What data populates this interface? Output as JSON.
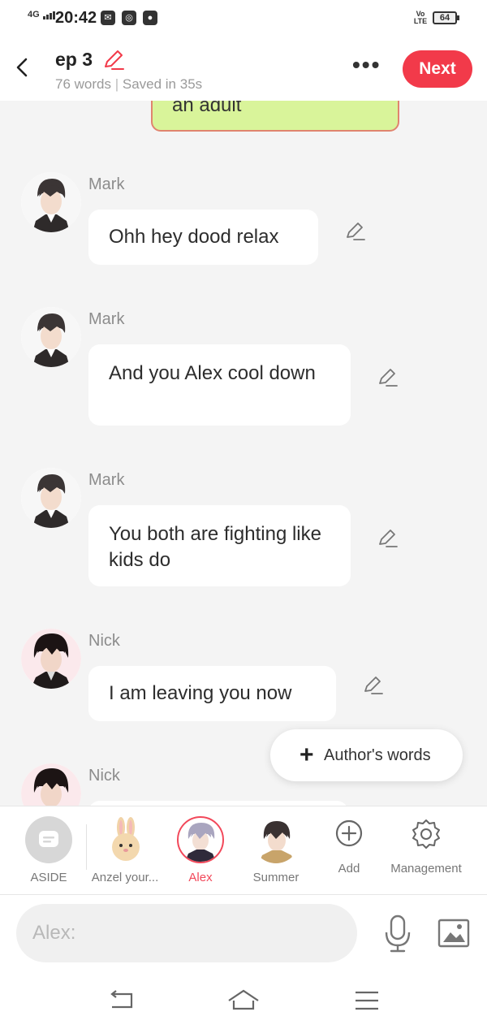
{
  "status_bar": {
    "network": "4G",
    "time": "20:42",
    "volte": "Vo LTE",
    "battery": "64"
  },
  "header": {
    "title": "ep 3",
    "word_count": "76 words",
    "saved_status": "Saved in 35s",
    "next_label": "Next"
  },
  "chat": {
    "previous_bubble_text": "an adult",
    "messages": [
      {
        "speaker": "Mark",
        "text": "Ohh hey dood relax"
      },
      {
        "speaker": "Mark",
        "text": "And you Alex cool down"
      },
      {
        "speaker": "Mark",
        "text": "You both are fighting like kids do"
      },
      {
        "speaker": "Nick",
        "text": "I am leaving you now"
      },
      {
        "speaker": "Nick",
        "text": ""
      }
    ]
  },
  "authors_words_label": "Author's words",
  "characters": [
    {
      "name": "ASIDE"
    },
    {
      "name": "Anzel your..."
    },
    {
      "name": "Alex",
      "selected": true
    },
    {
      "name": "Summer"
    },
    {
      "name": "Add"
    },
    {
      "name": "Management"
    }
  ],
  "input": {
    "placeholder": "Alex:"
  },
  "colors": {
    "accent": "#f23a4a",
    "selected_name": "#f2485a",
    "previous_bubble": "#d9f49a"
  }
}
